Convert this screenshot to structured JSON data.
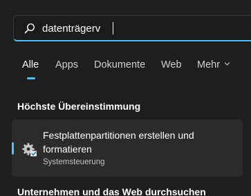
{
  "search": {
    "value": "datenträgerv"
  },
  "tabs": [
    {
      "label": "Alle"
    },
    {
      "label": "Apps"
    },
    {
      "label": "Dokumente"
    },
    {
      "label": "Web"
    },
    {
      "label": "Mehr"
    }
  ],
  "sections": {
    "best_match_heading": "Höchste Übereinstimmung",
    "web_heading": "Unternehmen und das Web durchsuchen"
  },
  "best_match": {
    "title": "Festplattenpartitionen erstellen und formatieren",
    "subtitle": "Systemsteuerung",
    "icon": "gear-with-checkbox-icon"
  },
  "colors": {
    "accent": "#4cc2ff",
    "background": "#1e1e1e",
    "card": "#2b2b2b"
  }
}
